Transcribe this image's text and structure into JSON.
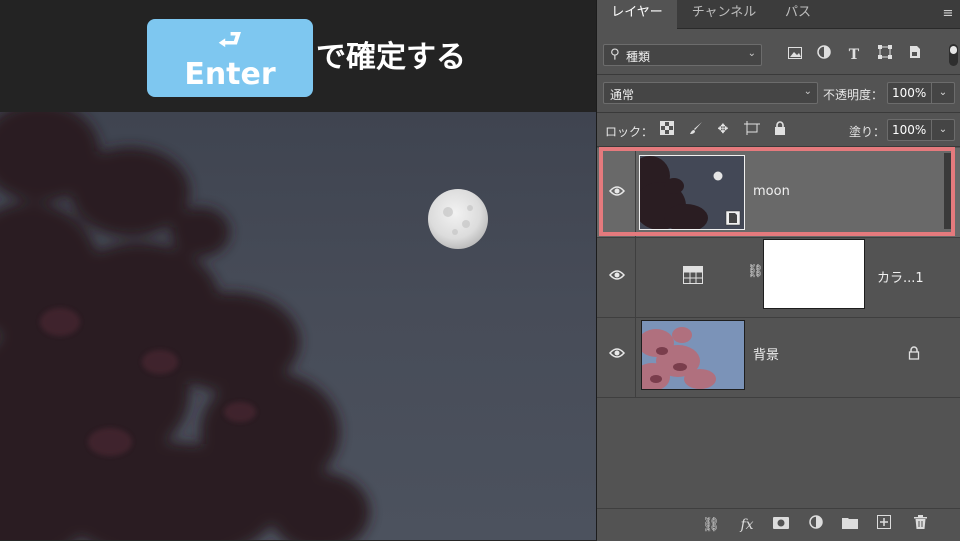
{
  "overlay": {
    "enter_arrow": "⮐",
    "enter_label": "Enter",
    "instruction": "で確定する",
    "badge_color": "#7ec7f0"
  },
  "panel": {
    "tabs": [
      {
        "label": "レイヤー",
        "active": true
      },
      {
        "label": "チャンネル",
        "active": false
      },
      {
        "label": "パス",
        "active": false
      }
    ],
    "menu_icon": "panel-menu-icon",
    "filter": {
      "label": "種類",
      "icons": [
        "image-filter-icon",
        "adjustment-filter-icon",
        "type-filter-icon",
        "shape-filter-icon",
        "smart-object-filter-icon"
      ]
    },
    "blend_mode": "通常",
    "opacity_label": "不透明度：",
    "opacity_value": "100%",
    "lock_label": "ロック：",
    "lock_icons": [
      "lock-transparent-icon",
      "lock-paint-icon",
      "lock-position-icon",
      "lock-artboard-icon",
      "lock-all-icon"
    ],
    "fill_label": "塗り：",
    "fill_value": "100%",
    "layers": [
      {
        "name": "moon",
        "type": "smart-object",
        "selected": true,
        "visible": true
      },
      {
        "name": "カラ...1",
        "type": "adjustment",
        "selected": false,
        "visible": true
      },
      {
        "name": "背景",
        "type": "background",
        "selected": false,
        "visible": true,
        "locked": true
      }
    ],
    "bottom_icons": [
      "link-layers-icon",
      "fx-icon",
      "add-mask-icon",
      "new-adjustment-icon",
      "new-group-icon",
      "new-layer-icon",
      "delete-layer-icon"
    ],
    "highlight_color": "#e57a7d"
  }
}
